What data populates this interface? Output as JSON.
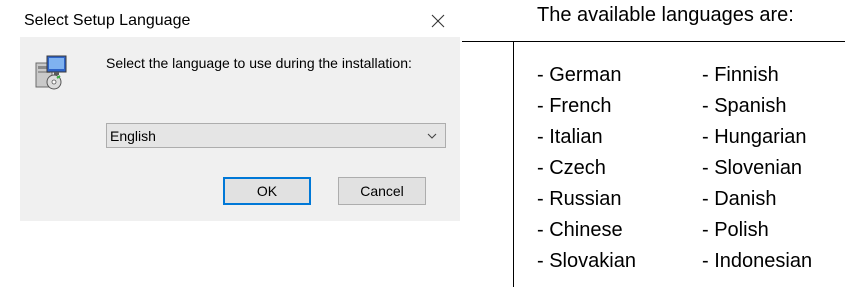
{
  "dialog": {
    "title": "Select Setup Language",
    "prompt": "Select the language to use during the installation:",
    "selected_language": "English",
    "ok_label": "OK",
    "cancel_label": "Cancel",
    "icons": {
      "close": "close-icon",
      "setup": "setup-installer-icon",
      "dropdown": "chevron-down-icon"
    },
    "colors": {
      "default_button_border": "#0078d7",
      "dialog_background": "#f0f0f0"
    }
  },
  "languages": {
    "heading": "The available languages are:",
    "left_column": [
      "- German",
      "- French",
      "- Italian",
      "- Czech",
      "- Russian",
      "- Chinese",
      "- Slovakian"
    ],
    "right_column": [
      "- Finnish",
      "- Spanish",
      "- Hungarian",
      "- Slovenian",
      "- Danish",
      "- Polish",
      "- Indonesian"
    ]
  }
}
